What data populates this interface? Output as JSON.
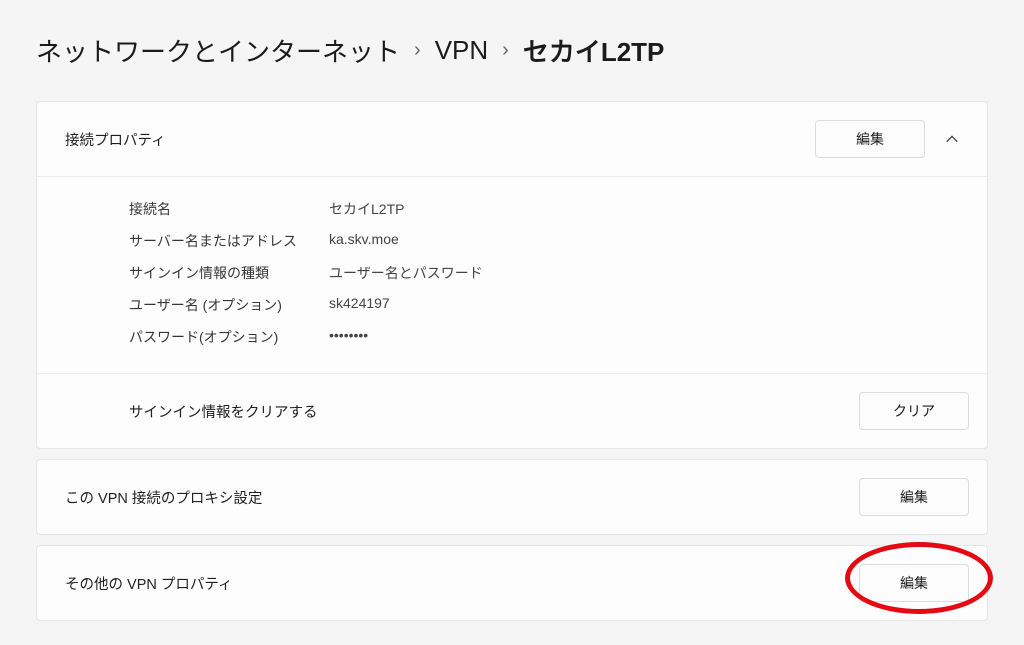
{
  "breadcrumb": {
    "root": "ネットワークとインターネット",
    "sep": "›",
    "mid": "VPN",
    "current": "セカイL2TP"
  },
  "connection_properties": {
    "title": "接続プロパティ",
    "edit_label": "編集",
    "rows": {
      "name_label": "接続名",
      "name_value": "セカイL2TP",
      "server_label": "サーバー名またはアドレス",
      "server_value": "ka.skv.moe",
      "signin_type_label": "サインイン情報の種類",
      "signin_type_value": "ユーザー名とパスワード",
      "username_label": "ユーザー名 (オプション)",
      "username_value": "sk424197",
      "password_label": "パスワード(オプション)",
      "password_value": "••••••••"
    },
    "clear_signin": {
      "label": "サインイン情報をクリアする",
      "button": "クリア"
    }
  },
  "proxy": {
    "title": "この VPN 接続のプロキシ設定",
    "edit_label": "編集"
  },
  "other": {
    "title": "その他の VPN プロパティ",
    "edit_label": "編集"
  }
}
